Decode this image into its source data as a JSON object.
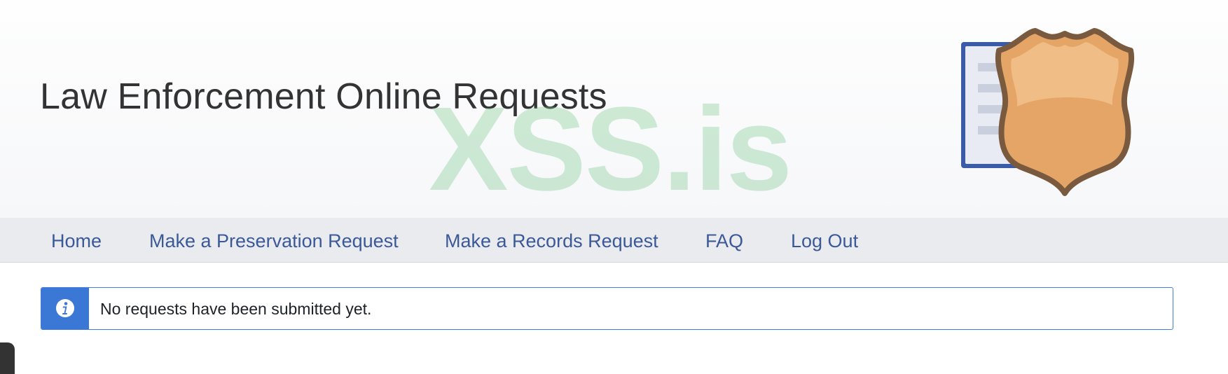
{
  "header": {
    "site_title": "Law Enforcement Online Requests",
    "watermark": "XSS.is",
    "logo_icon": "police-shield-document-icon"
  },
  "nav": {
    "items": [
      {
        "label": "Home"
      },
      {
        "label": "Make a Preservation Request"
      },
      {
        "label": "Make a Records Request"
      },
      {
        "label": "FAQ"
      },
      {
        "label": "Log Out"
      }
    ]
  },
  "alert": {
    "icon": "info-icon",
    "message": "No requests have been submitted yet."
  },
  "colors": {
    "nav_link": "#3b5998",
    "alert_accent": "#3b78d6",
    "nav_bar": "#e9ebee",
    "watermark": "#78c88c"
  }
}
